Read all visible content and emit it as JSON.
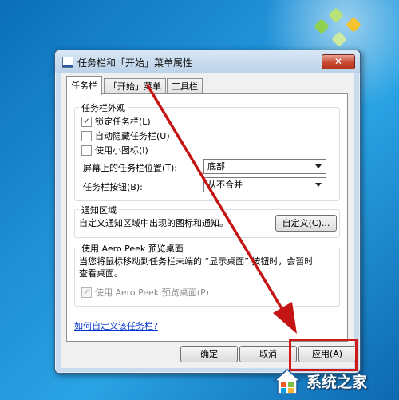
{
  "dialog": {
    "title": "任务栏和「开始」菜单属性",
    "close_glyph": "✕",
    "tabs": [
      {
        "label": "任务栏",
        "active": true
      },
      {
        "label": "「开始」菜单",
        "active": false
      },
      {
        "label": "工具栏",
        "active": false
      }
    ]
  },
  "appearance": {
    "legend": "任务栏外观",
    "lock_taskbar": {
      "label": "锁定任务栏(L)",
      "checked": true
    },
    "autohide": {
      "label": "自动隐藏任务栏(U)",
      "checked": false
    },
    "small_icons": {
      "label": "使用小图标(I)",
      "checked": false
    },
    "location_label": "屏幕上的任务栏位置(T):",
    "location_value": "底部",
    "buttons_label": "任务栏按钮(B):",
    "buttons_value": "从不合并"
  },
  "notification": {
    "legend": "通知区域",
    "description": "自定义通知区域中出现的图标和通知。",
    "customize_button": "自定义(C)..."
  },
  "aero_peek": {
    "legend": "使用 Aero Peek 预览桌面",
    "description": "当您将鼠标移动到任务栏末端的 “显示桌面” 按钮时，会暂时查看桌面。",
    "checkbox": {
      "label": "使用 Aero Peek 预览桌面(P)",
      "checked": true,
      "disabled": true
    }
  },
  "help_link": "如何自定义该任务栏?",
  "buttons": {
    "ok": "确定",
    "cancel": "取消",
    "apply": "应用(A)"
  },
  "check_glyph": "✓",
  "watermark": {
    "text": "系统之家"
  },
  "colors": {
    "highlight": "#d01818",
    "link": "#0033cc"
  }
}
